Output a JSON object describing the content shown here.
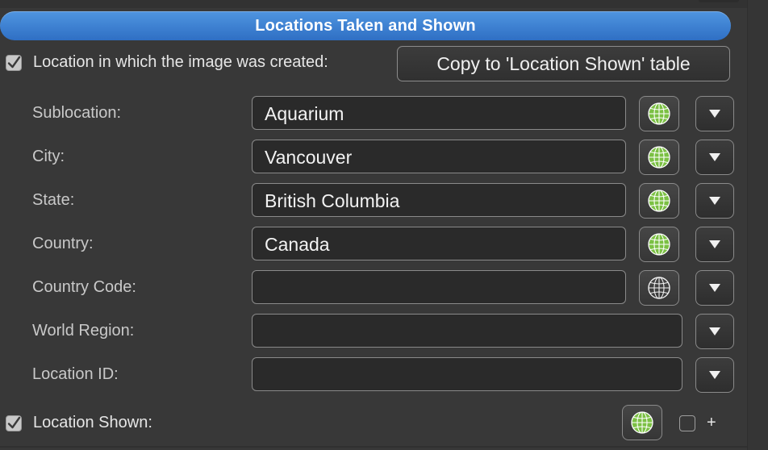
{
  "header": {
    "title": "Locations Taken and Shown"
  },
  "location_created": {
    "label": "Location in which the image was created:",
    "copy_button_label": "Copy to 'Location Shown' table",
    "checked": true
  },
  "fields": [
    {
      "label": "Sublocation:",
      "value": "Aquarium",
      "globe": "globe-icon-green"
    },
    {
      "label": "City:",
      "value": "Vancouver",
      "globe": "globe-icon-green"
    },
    {
      "label": "State:",
      "value": "British Columbia",
      "globe": "globe-icon-green"
    },
    {
      "label": "Country:",
      "value": "Canada",
      "globe": "globe-icon-green"
    },
    {
      "label": "Country Code:",
      "value": "",
      "globe": "globe-icon-outline"
    },
    {
      "label": "World Region:",
      "value": ""
    },
    {
      "label": "Location ID:",
      "value": ""
    }
  ],
  "location_shown": {
    "label": "Location Shown:",
    "checked": true,
    "add_label": "+"
  },
  "colors": {
    "header_blue": "#3a80d4",
    "globe_green": "#7bc043",
    "background": "#383838"
  }
}
